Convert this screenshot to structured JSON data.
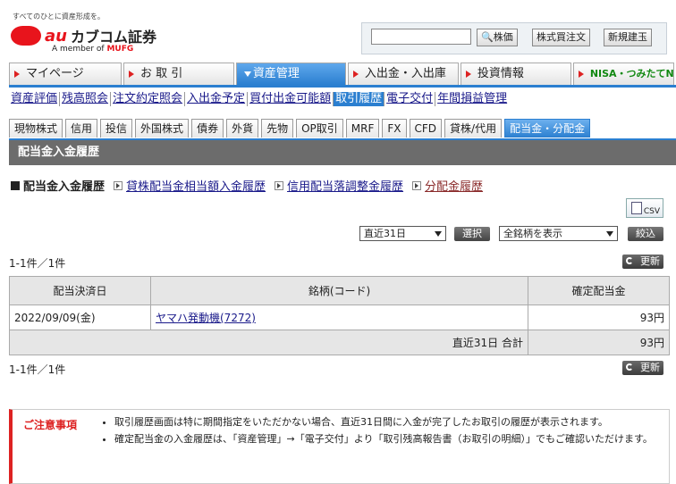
{
  "header": {
    "tagline": "すべてのひとに資産形成を。",
    "brand_mark": "au",
    "brand_name": "カブコム証券",
    "member_prefix": "A member of ",
    "member_group": "MUFG",
    "search_placeholder": "",
    "search_btn": "株価",
    "order_btn": "株式買注文",
    "new_btn": "新規建玉"
  },
  "main_tabs": [
    {
      "label": "マイページ"
    },
    {
      "label": "お 取 引"
    },
    {
      "label": "資産管理"
    },
    {
      "label": "入出金・入出庫"
    },
    {
      "label": "投資情報"
    },
    {
      "label": "NISA・つみたてNISA"
    }
  ],
  "sub_nav": [
    "資産評価",
    "残高照会",
    "注文約定照会",
    "入出金予定",
    "買付出金可能額",
    "取引履歴",
    "電子交付",
    "年間損益管理"
  ],
  "product_tabs": [
    "現物株式",
    "信用",
    "投信",
    "外国株式",
    "債券",
    "外貨",
    "先物",
    "OP取引",
    "MRF",
    "FX",
    "CFD",
    "貸株/代用",
    "配当金・分配金"
  ],
  "page_title": "配当金入金履歴",
  "sub_links": [
    "配当金入金履歴",
    "貸株配当金相当額入金履歴",
    "信用配当落調整金履歴",
    "分配金履歴"
  ],
  "csv_label": "CSV",
  "period_select": "直近31日",
  "select_btn": "選択",
  "brand_select": "全銘柄を表示",
  "filter_btn": "絞込",
  "count_text": "1-1件／1件",
  "refresh_label": "更新",
  "table": {
    "headers": [
      "配当決済日",
      "銘柄(コード)",
      "確定配当金"
    ],
    "rows": [
      {
        "date": "2022/09/09(金)",
        "name": "ヤマハ発動機(7272)",
        "amount": "93円"
      }
    ],
    "total_label": "直近31日 合計",
    "total_amount": "93円"
  },
  "notice": {
    "heading": "ご注意事項",
    "items": [
      "取引履歴画面は特に期間指定をいただかない場合、直近31日間に入金が完了したお取引の履歴が表示されます。",
      "確定配当金の入金履歴は、「資産管理」→「電子交付」より「取引残高報告書（お取引の明細）」でもご確認いただけます。"
    ]
  }
}
